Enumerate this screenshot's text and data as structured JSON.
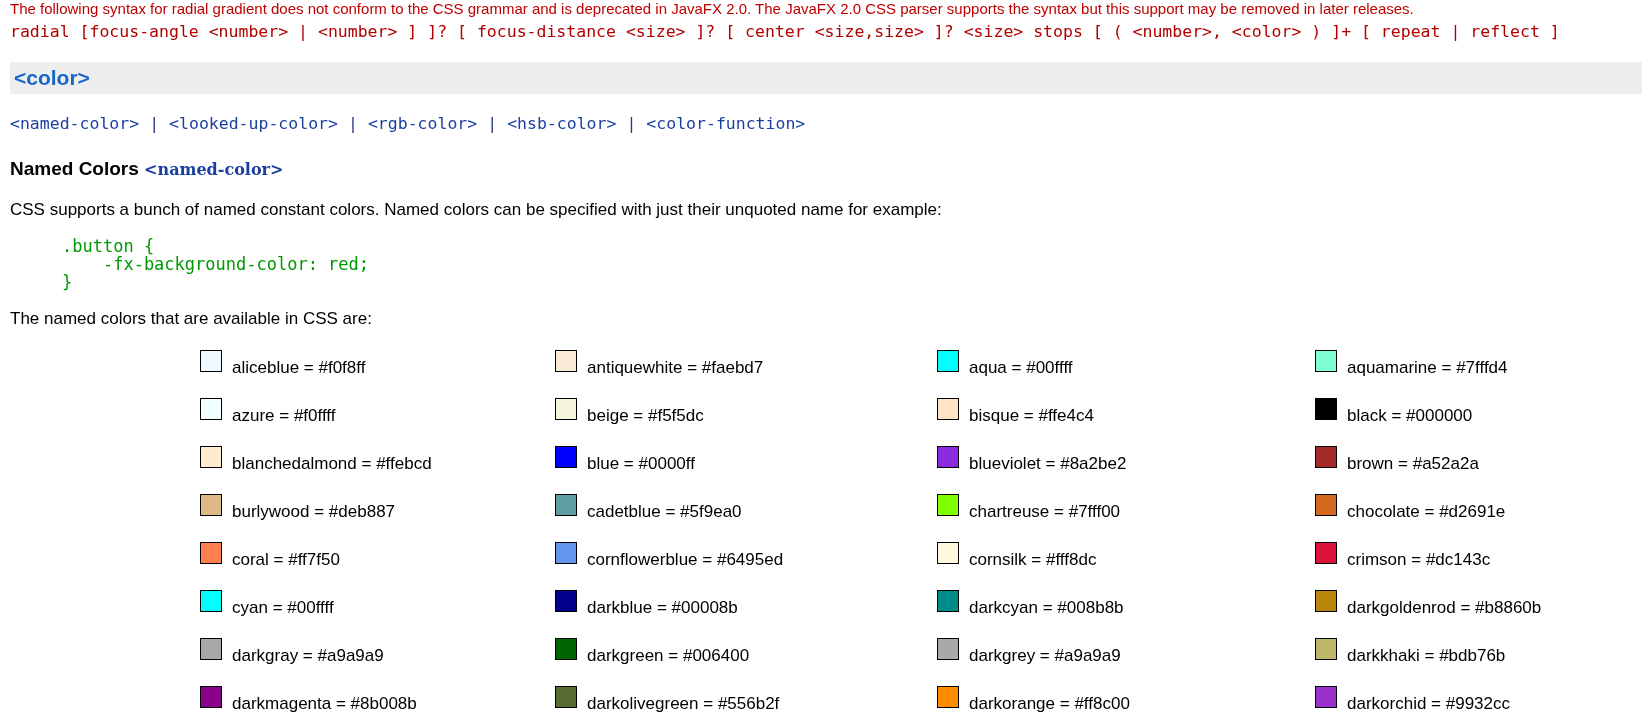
{
  "notice": "The following syntax for radial gradient does not conform to the CSS grammar and is deprecated in JavaFX 2.0. The JavaFX 2.0 CSS parser supports the syntax but this support may be removed in later releases.",
  "syntax": "radial [focus-angle <number> | <number> ] ]? [ focus-distance <size> ]? [ center <size,size> ]? <size> stops [ ( <number>, <color> ) ]+ [ repeat | reflect ]",
  "section_title": "<color>",
  "type_links": [
    {
      "kind": "link",
      "text": "<named-color>"
    },
    {
      "kind": "separator",
      "text": "|"
    },
    {
      "kind": "link",
      "text": "<looked-up-color>"
    },
    {
      "kind": "separator",
      "text": "|"
    },
    {
      "kind": "link",
      "text": "<rgb-color>"
    },
    {
      "kind": "separator",
      "text": "|"
    },
    {
      "kind": "link",
      "text": "<hsb-color>"
    },
    {
      "kind": "separator",
      "text": "|"
    },
    {
      "kind": "link",
      "text": "<color-function>"
    }
  ],
  "subheading": {
    "title": "Named Colors",
    "tag": "<named-color>"
  },
  "intro": "CSS supports a bunch of named constant colors. Named colors can be specified with just their unquoted name for example:",
  "code": [
    ".button {",
    "    -fx-background-color: red;",
    "}"
  ],
  "list_intro": "The named colors that are available in CSS are:",
  "colors": [
    {
      "label": "aliceblue = #f0f8ff",
      "color": "#f0f8ff"
    },
    {
      "label": "antiquewhite = #faebd7",
      "color": "#faebd7"
    },
    {
      "label": "aqua = #00ffff",
      "color": "#00ffff"
    },
    {
      "label": "aquamarine = #7fffd4",
      "color": "#7fffd4"
    },
    {
      "label": "azure = #f0ffff",
      "color": "#f0ffff"
    },
    {
      "label": "beige = #f5f5dc",
      "color": "#f5f5dc"
    },
    {
      "label": "bisque = #ffe4c4",
      "color": "#ffe4c4"
    },
    {
      "label": "black = #000000",
      "color": "#000000"
    },
    {
      "label": "blanchedalmond = #ffebcd",
      "color": "#ffebcd"
    },
    {
      "label": "blue = #0000ff",
      "color": "#0000ff"
    },
    {
      "label": "blueviolet = #8a2be2",
      "color": "#8a2be2"
    },
    {
      "label": "brown = #a52a2a",
      "color": "#a52a2a"
    },
    {
      "label": "burlywood = #deb887",
      "color": "#deb887"
    },
    {
      "label": "cadetblue = #5f9ea0",
      "color": "#5f9ea0"
    },
    {
      "label": "chartreuse = #7fff00",
      "color": "#7fff00"
    },
    {
      "label": "chocolate = #d2691e",
      "color": "#d2691e"
    },
    {
      "label": "coral = #ff7f50",
      "color": "#ff7f50"
    },
    {
      "label": "cornflowerblue = #6495ed",
      "color": "#6495ed"
    },
    {
      "label": "cornsilk = #fff8dc",
      "color": "#fff8dc"
    },
    {
      "label": "crimson = #dc143c",
      "color": "#dc143c"
    },
    {
      "label": "cyan = #00ffff",
      "color": "#00ffff"
    },
    {
      "label": "darkblue = #00008b",
      "color": "#00008b"
    },
    {
      "label": "darkcyan = #008b8b",
      "color": "#008b8b"
    },
    {
      "label": "darkgoldenrod = #b8860b",
      "color": "#b8860b"
    },
    {
      "label": "darkgray = #a9a9a9",
      "color": "#a9a9a9"
    },
    {
      "label": "darkgreen = #006400",
      "color": "#006400"
    },
    {
      "label": "darkgrey = #a9a9a9",
      "color": "#a9a9a9"
    },
    {
      "label": "darkkhaki = #bdb76b",
      "color": "#bdb76b"
    },
    {
      "label": "darkmagenta = #8b008b",
      "color": "#8b008b"
    },
    {
      "label": "darkolivegreen = #556b2f",
      "color": "#556b2f"
    },
    {
      "label": "darkorange = #ff8c00",
      "color": "#ff8c00"
    },
    {
      "label": "darkorchid = #9932cc",
      "color": "#9932cc"
    }
  ]
}
